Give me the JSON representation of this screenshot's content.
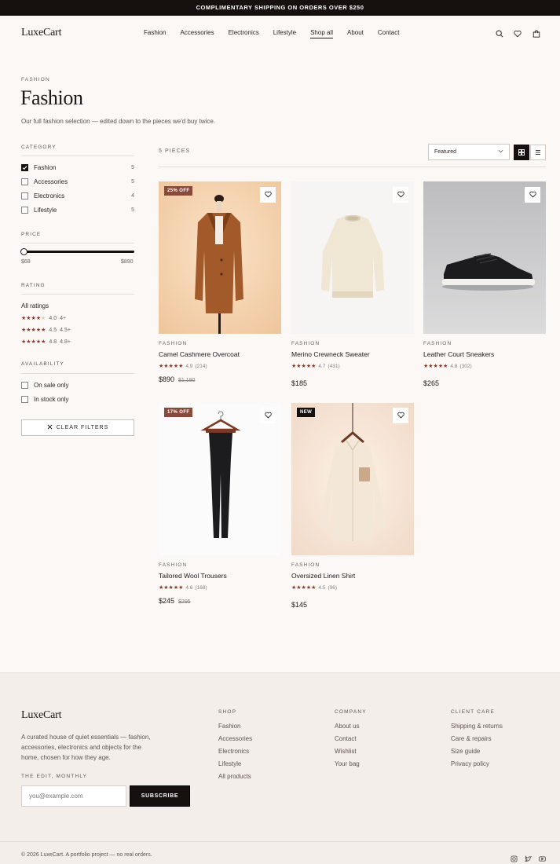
{
  "announcement": "COMPLIMENTARY SHIPPING ON ORDERS OVER $250",
  "header": {
    "logo": "LuxeCart",
    "nav": [
      "Fashion",
      "Accessories",
      "Electronics",
      "Lifestyle",
      "Shop all",
      "About",
      "Contact"
    ],
    "active_nav": "Shop all",
    "icons": [
      "search-icon",
      "heart-icon",
      "bag-icon"
    ]
  },
  "page": {
    "eyebrow": "FASHION",
    "title": "Fashion",
    "description": "Our full fashion selection — edited down to the pieces we'd buy twice."
  },
  "filters": {
    "category_heading": "CATEGORY",
    "categories": [
      {
        "label": "Fashion",
        "count": "5",
        "checked": true
      },
      {
        "label": "Accessories",
        "count": "5",
        "checked": false
      },
      {
        "label": "Electronics",
        "count": "4",
        "checked": false
      },
      {
        "label": "Lifestyle",
        "count": "5",
        "checked": false
      }
    ],
    "price_heading": "PRICE",
    "price_min": "$68",
    "price_max": "$890",
    "rating_heading": "RATING",
    "rating_all": "All ratings",
    "ratings": [
      {
        "value": "4.0",
        "label": "4+",
        "stars": 4
      },
      {
        "value": "4.5",
        "label": "4.5+",
        "stars": 5
      },
      {
        "value": "4.8",
        "label": "4.8+",
        "stars": 5
      }
    ],
    "availability_heading": "AVAILABILITY",
    "availability": [
      "On sale only",
      "In stock only"
    ],
    "clear_label": "CLEAR FILTERS"
  },
  "toolbar": {
    "count_label": "5 PIECES",
    "sort_value": "Featured"
  },
  "products": [
    {
      "category": "FASHION",
      "name": "Camel Cashmere Overcoat",
      "rating": "4.9",
      "reviews": "(214)",
      "price": "$890",
      "old_price": "$1,180",
      "badge": "25% OFF",
      "badge_color": "#8a4a3a"
    },
    {
      "category": "FASHION",
      "name": "Merino Crewneck Sweater",
      "rating": "4.7",
      "reviews": "(431)",
      "price": "$185",
      "old_price": "",
      "badge": "",
      "badge_color": ""
    },
    {
      "category": "FASHION",
      "name": "Leather Court Sneakers",
      "rating": "4.8",
      "reviews": "(302)",
      "price": "$265",
      "old_price": "",
      "badge": "",
      "badge_color": ""
    },
    {
      "category": "FASHION",
      "name": "Tailored Wool Trousers",
      "rating": "4.6",
      "reviews": "(168)",
      "price": "$245",
      "old_price": "$295",
      "badge": "17% OFF",
      "badge_color": "#8a4a3a"
    },
    {
      "category": "FASHION",
      "name": "Oversized Linen Shirt",
      "rating": "4.5",
      "reviews": "(96)",
      "price": "$145",
      "old_price": "",
      "badge": "NEW",
      "badge_color": "#16110f"
    }
  ],
  "footer": {
    "logo": "LuxeCart",
    "blurb": "A curated house of quiet essentials — fashion, accessories, electronics and objects for the home, chosen for how they age.",
    "newsletter_heading": "THE EDIT, MONTHLY",
    "email_placeholder": "you@example.com",
    "subscribe_label": "SUBSCRIBE",
    "columns": [
      {
        "heading": "SHOP",
        "links": [
          "Fashion",
          "Accessories",
          "Electronics",
          "Lifestyle",
          "All products"
        ]
      },
      {
        "heading": "COMPANY",
        "links": [
          "About us",
          "Contact",
          "Wishlist",
          "Your bag"
        ]
      },
      {
        "heading": "CLIENT CARE",
        "links": [
          "Shipping & returns",
          "Care & repairs",
          "Size guide",
          "Privacy policy"
        ]
      }
    ],
    "copyright": "© 2026 LuxeCart. A portfolio project — no real orders.",
    "social_icons": [
      "instagram-icon",
      "twitter-icon",
      "youtube-icon"
    ]
  }
}
